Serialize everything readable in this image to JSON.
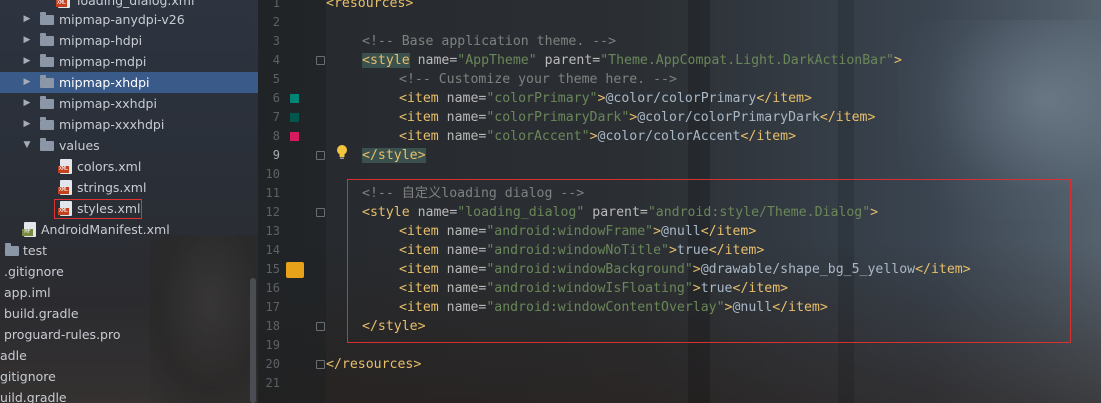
{
  "tree": {
    "items": [
      {
        "label": "loading_dialog.xml",
        "kind": "file"
      },
      {
        "label": "mipmap-anydpi-v26",
        "kind": "folder",
        "caret": "▶"
      },
      {
        "label": "mipmap-hdpi",
        "kind": "folder",
        "caret": "▶"
      },
      {
        "label": "mipmap-mdpi",
        "kind": "folder",
        "caret": "▶"
      },
      {
        "label": "mipmap-xhdpi",
        "kind": "folder",
        "caret": "▶",
        "selected": true
      },
      {
        "label": "mipmap-xxhdpi",
        "kind": "folder",
        "caret": "▶"
      },
      {
        "label": "mipmap-xxxhdpi",
        "kind": "folder",
        "caret": "▶"
      },
      {
        "label": "values",
        "kind": "folder",
        "caret": "▼"
      },
      {
        "label": "colors.xml",
        "kind": "file"
      },
      {
        "label": "strings.xml",
        "kind": "file"
      },
      {
        "label": "styles.xml",
        "kind": "file",
        "highlighted": true
      },
      {
        "label": "AndroidManifest.xml",
        "kind": "manifest"
      },
      {
        "label": "test",
        "kind": "folder"
      },
      {
        "label": ".gitignore",
        "kind": "plain"
      },
      {
        "label": "app.iml",
        "kind": "plain"
      },
      {
        "label": "build.gradle",
        "kind": "plain"
      },
      {
        "label": "proguard-rules.pro",
        "kind": "plain"
      },
      {
        "label": "adle",
        "kind": "plain"
      },
      {
        "label": "gitignore",
        "kind": "plain"
      },
      {
        "label": "uild.gradle",
        "kind": "plain"
      }
    ],
    "file_tag": "XML",
    "manifest_tag": "MF"
  },
  "editor": {
    "line_numbers": [
      "1",
      "2",
      "3",
      "4",
      "5",
      "6",
      "7",
      "8",
      "9",
      "10",
      "11",
      "12",
      "13",
      "14",
      "15",
      "16",
      "17",
      "18",
      "19",
      "20",
      "21"
    ],
    "current_line": "9",
    "lines": {
      "l1": {
        "t1": "<resources>"
      },
      "l3": {
        "cmt": "<!-- Base application theme. -->"
      },
      "l4": {
        "tag": "<style",
        "attr": " name=",
        "v1": "\"AppTheme\"",
        "attr2": " parent=",
        "v2": "\"Theme.AppCompat.Light.DarkActionBar\"",
        "end": ">"
      },
      "l5": {
        "cmt": "<!-- Customize your theme here. -->"
      },
      "l6": {
        "tag": "<item",
        "attr": " name=",
        "val": "\"colorPrimary\"",
        "gt": ">",
        "txt": "@color/colorPrimary",
        "close": "</item>"
      },
      "l7": {
        "tag": "<item",
        "attr": " name=",
        "val": "\"colorPrimaryDark\"",
        "gt": ">",
        "txt": "@color/colorPrimaryDark",
        "close": "</item>"
      },
      "l8": {
        "tag": "<item",
        "attr": " name=",
        "val": "\"colorAccent\"",
        "gt": ">",
        "txt": "@color/colorAccent",
        "close": "</item>"
      },
      "l9": {
        "close": "</style>"
      },
      "l11": {
        "cmt": "<!-- 自定义loading dialog -->"
      },
      "l12": {
        "tag": "<style",
        "attr": " name=",
        "v1": "\"loading_dialog\"",
        "attr2": " parent=",
        "v2": "\"android:style/Theme.Dialog\"",
        "end": ">"
      },
      "l13": {
        "tag": "<item",
        "attr": " name=",
        "val": "\"android:windowFrame\"",
        "gt": ">",
        "txt": "@null",
        "close": "</item>"
      },
      "l14": {
        "tag": "<item",
        "attr": " name=",
        "val": "\"android:windowNoTitle\"",
        "gt": ">",
        "txt": "true",
        "close": "</item>"
      },
      "l15": {
        "tag": "<item",
        "attr": " name=",
        "val": "\"android:windowBackground\"",
        "gt": ">",
        "txt": "@drawable/shape_bg_5_yellow",
        "close": "</item>"
      },
      "l16": {
        "tag": "<item",
        "attr": " name=",
        "val": "\"android:windowIsFloating\"",
        "gt": ">",
        "txt": "true",
        "close": "</item>"
      },
      "l17": {
        "tag": "<item",
        "attr": " name=",
        "val": "\"android:windowContentOverlay\"",
        "gt": ">",
        "txt": "@null",
        "close": "</item>"
      },
      "l18": {
        "close": "</style>"
      },
      "l20": {
        "t1": "</resources>"
      }
    },
    "gutter_colors": {
      "colorPrimary": "#008577",
      "colorPrimaryDark": "#00574B",
      "colorAccent": "#D81B60",
      "warning": "#E8A21A"
    }
  }
}
